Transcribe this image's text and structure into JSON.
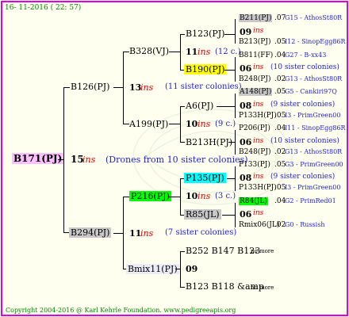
{
  "date_line": "16- 11-2016 ( 22: 57)",
  "root": {
    "name": "B171(PJ)",
    "gen": "15",
    "ins": "ins",
    "note": "(Drones from 10 sister colonies)"
  },
  "dam": {
    "name": "B126(PJ)",
    "gen": "13",
    "ins": "ins",
    "note": "(11 sister colonies)"
  },
  "drone": {
    "name": "B294(PJ)",
    "gen": "11",
    "ins": "ins",
    "note": "(7 sister colonies)"
  },
  "g3": {
    "b328": {
      "name": "B328(VJ)"
    },
    "a199": {
      "name": "A199(PJ)"
    },
    "p216": {
      "name": "P216(PJ)"
    },
    "bmix11": {
      "name": "Bmix11(PJ)"
    }
  },
  "g4": {
    "b123": {
      "name": "B123(PJ)"
    },
    "g11": {
      "gen": "11",
      "ins": "ins",
      "note": "(12 c.)"
    },
    "b190": {
      "name": "B190(PJ)"
    },
    "a6": {
      "name": "A6(PJ)"
    },
    "g10a": {
      "gen": "10",
      "ins": "ins",
      "note": "(9 c.)"
    },
    "b213h": {
      "name": "B213H(PJ)"
    },
    "p135": {
      "name": "P135(PJ)"
    },
    "g10b": {
      "gen": "10",
      "ins": "ins",
      "note": "(3 c.)"
    },
    "r85": {
      "name": "R85(JL)"
    },
    "bmix_gen": {
      "gen": "09"
    },
    "b252": {
      "text": "B252 B147 B123",
      "nm": "no more"
    },
    "b123b": {
      "text": "B123 B118 &amp",
      "nm": "no more"
    }
  },
  "g5": [
    {
      "name": "B211(PJ)",
      "val": ".07",
      "code": "G15 - AthosSt80R"
    },
    {
      "name": "09",
      "ins": "ins"
    },
    {
      "name": "B213(PJ)",
      "val": ".05",
      "code": "I12 - SinopEgg86R"
    },
    {
      "name": "B811(FF)",
      "val": ".04",
      "code": "G27 - B-xx43"
    },
    {
      "name": "06",
      "ins": "ins",
      "note": "(10 sister colonies)"
    },
    {
      "name": "B248(PJ)",
      "val": ".02",
      "code": "G13 - AthosSt80R"
    },
    {
      "name": "A148(PJ)",
      "val": ".05",
      "code": "G5 - Cankiri97Q"
    },
    {
      "name": "08",
      "ins": "ins",
      "note": "(9 sister colonies)"
    },
    {
      "name": "P133H(PJ)",
      "val": ".05",
      "code": "I3 - PrimGreen00"
    },
    {
      "name": "P206(PJ)",
      "val": ".04",
      "code": "I11 - SinopEgg86R"
    },
    {
      "name": "06",
      "ins": "ins",
      "note": "(10 sister colonies)"
    },
    {
      "name": "B248(PJ)",
      "val": ".02",
      "code": "G13 - AthosSt80R"
    },
    {
      "name": "P133(PJ)",
      "val": ".05",
      "code": "G3 - PrimGreen00"
    },
    {
      "name": "08",
      "ins": "ins",
      "note": "(9 sister colonies)"
    },
    {
      "name": "P133H(PJ)",
      "val": ".05",
      "code": "I3 - PrimGreen00"
    },
    {
      "name": "R84(JL)",
      "val": ".04",
      "code": "G2 - PrimRed01"
    },
    {
      "name": "06",
      "ins": "ins"
    },
    {
      "name": "Rmix06(JL)",
      "val": ".02",
      "code": "G0 - Russish"
    }
  ],
  "footer": "Copyright 2004-2016 @ Karl Kehrle Foundation.   www.pedigreeapis.org",
  "colors": {
    "frame": "#e000e0",
    "root_bg": "#ffc0ff",
    "yellow": "#ffff00",
    "cyan": "#00ffff",
    "green": "#00ff00",
    "grey": "#c8c8c8",
    "pale": "#ececf8",
    "ins": "#e00000",
    "note": "#2222cc"
  }
}
